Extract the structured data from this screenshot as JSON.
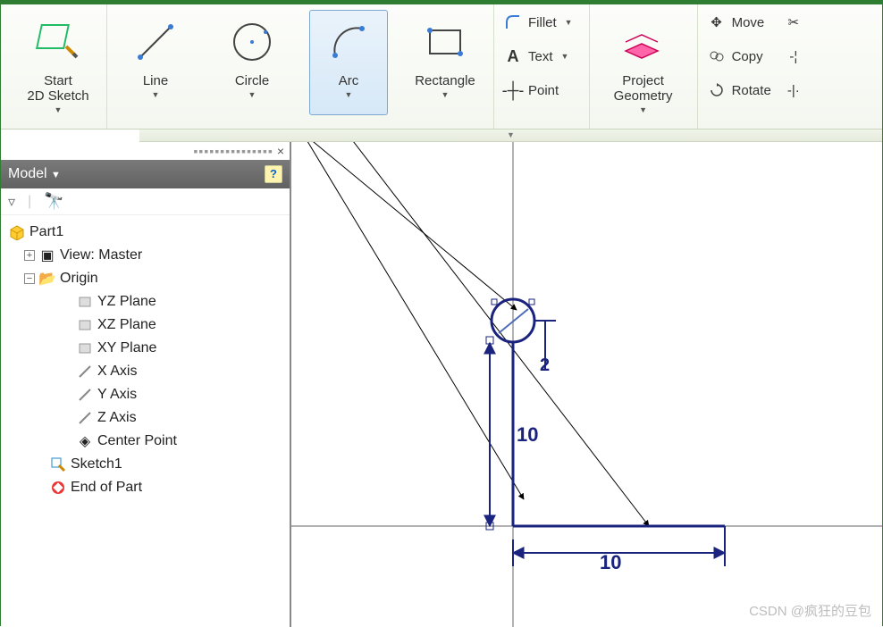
{
  "ribbon": {
    "start_sketch": "Start\n2D Sketch",
    "line": "Line",
    "circle": "Circle",
    "arc": "Arc",
    "rectangle": "Rectangle",
    "fillet": "Fillet",
    "text": "Text",
    "point": "Point",
    "project_geometry": "Project\nGeometry",
    "move": "Move",
    "copy": "Copy",
    "rotate": "Rotate"
  },
  "panel": {
    "title": "Model",
    "close_glyph": "×"
  },
  "tree": {
    "root": "Part1",
    "view": "View: Master",
    "origin": "Origin",
    "planes": [
      "YZ Plane",
      "XZ Plane",
      "XY Plane"
    ],
    "axes": [
      "X Axis",
      "Y Axis",
      "Z Axis"
    ],
    "center_point": "Center Point",
    "sketch": "Sketch1",
    "end": "End of Part"
  },
  "sketch_dims": {
    "d1": "2",
    "d2": "10",
    "d3": "10"
  },
  "watermark": "CSDN @疯狂的豆包"
}
